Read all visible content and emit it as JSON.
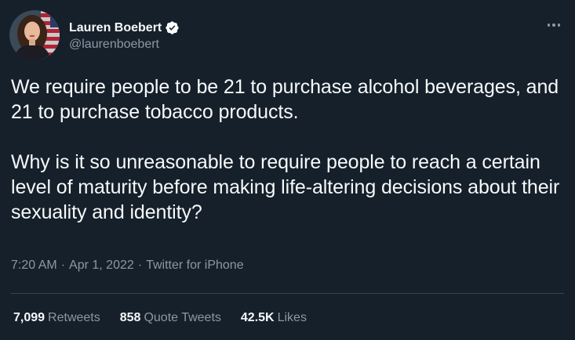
{
  "author": {
    "display_name": "Lauren Boebert",
    "handle": "@laurenboebert",
    "verified": true
  },
  "tweet": {
    "paragraphs": [
      "We require people to be 21 to purchase alcohol beverages, and 21 to purchase tobacco products.",
      "Why is it so unreasonable to require people to reach a certain level of maturity before making life-altering decisions about their sexuality and identity?"
    ],
    "time": "7:20 AM",
    "date": "Apr 1, 2022",
    "source": "Twitter for iPhone",
    "separator": "·"
  },
  "stats": {
    "retweets_count": "7,099",
    "retweets_label": "Retweets",
    "quotes_count": "858",
    "quotes_label": "Quote Tweets",
    "likes_count": "42.5K",
    "likes_label": "Likes"
  },
  "icons": {
    "verified": "verified-badge-icon",
    "more": "more-options-icon"
  },
  "colors": {
    "background": "#15202b",
    "primary_text": "#f7f9f9",
    "secondary_text": "#8b98a5",
    "divider": "#38444d",
    "verified_badge": "#ffffff"
  }
}
